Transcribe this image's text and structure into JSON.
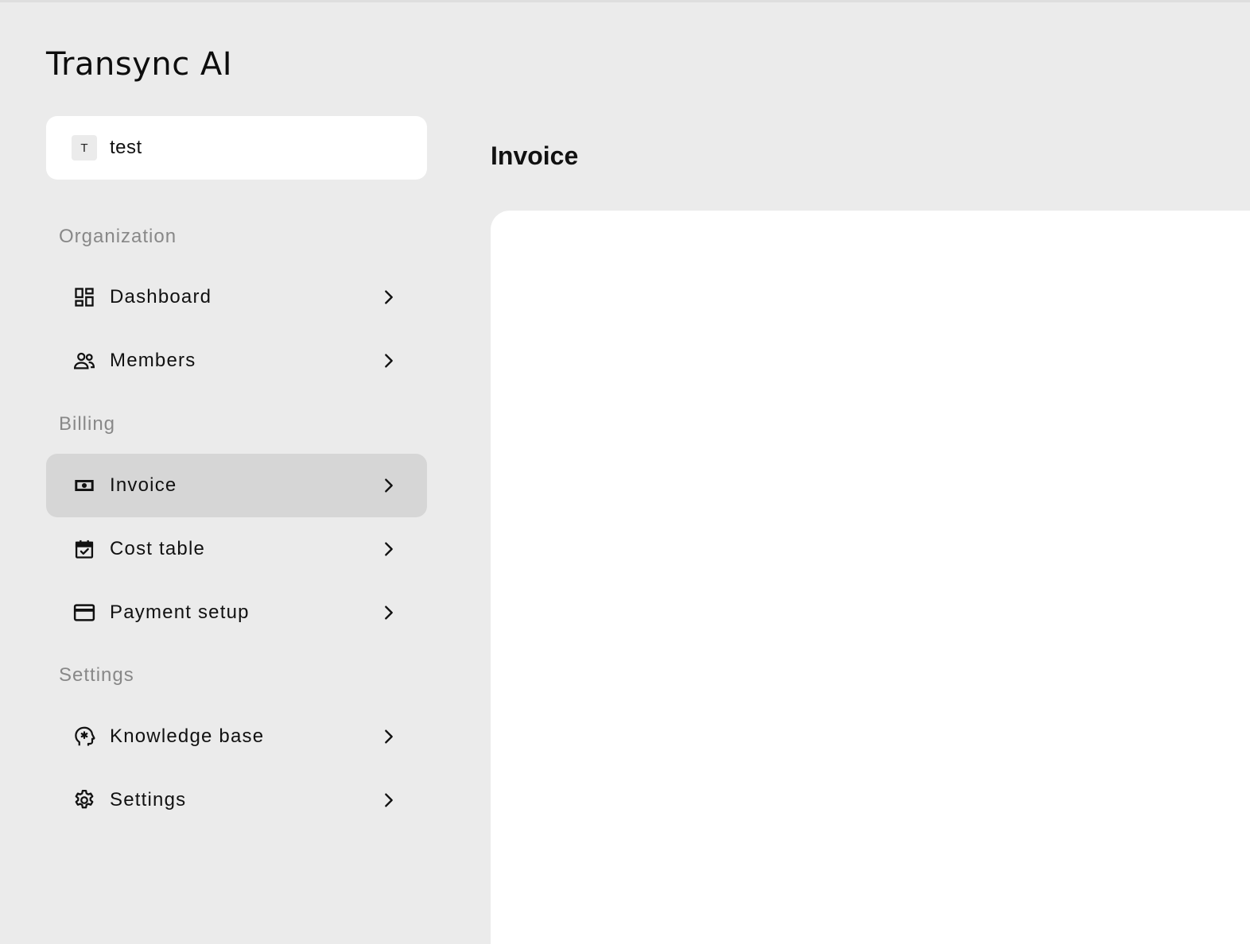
{
  "app": {
    "brand": "Transync AI"
  },
  "org": {
    "avatar_initial": "T",
    "name": "test"
  },
  "sidebar": {
    "sections": [
      {
        "label": "Organization",
        "items": [
          {
            "label": "Dashboard",
            "icon": "dashboard-icon"
          },
          {
            "label": "Members",
            "icon": "members-icon"
          }
        ]
      },
      {
        "label": "Billing",
        "items": [
          {
            "label": "Invoice",
            "icon": "invoice-icon",
            "active": true
          },
          {
            "label": "Cost table",
            "icon": "calendar-check-icon"
          },
          {
            "label": "Payment setup",
            "icon": "credit-card-icon"
          }
        ]
      },
      {
        "label": "Settings",
        "items": [
          {
            "label": "Knowledge base",
            "icon": "brain-head-icon"
          },
          {
            "label": "Settings",
            "icon": "gear-icon"
          }
        ]
      }
    ]
  },
  "main": {
    "title": "Invoice"
  },
  "colors": {
    "background": "#ebebeb",
    "active_item": "#d6d6d6",
    "section_label": "#888888",
    "panel": "#ffffff"
  }
}
